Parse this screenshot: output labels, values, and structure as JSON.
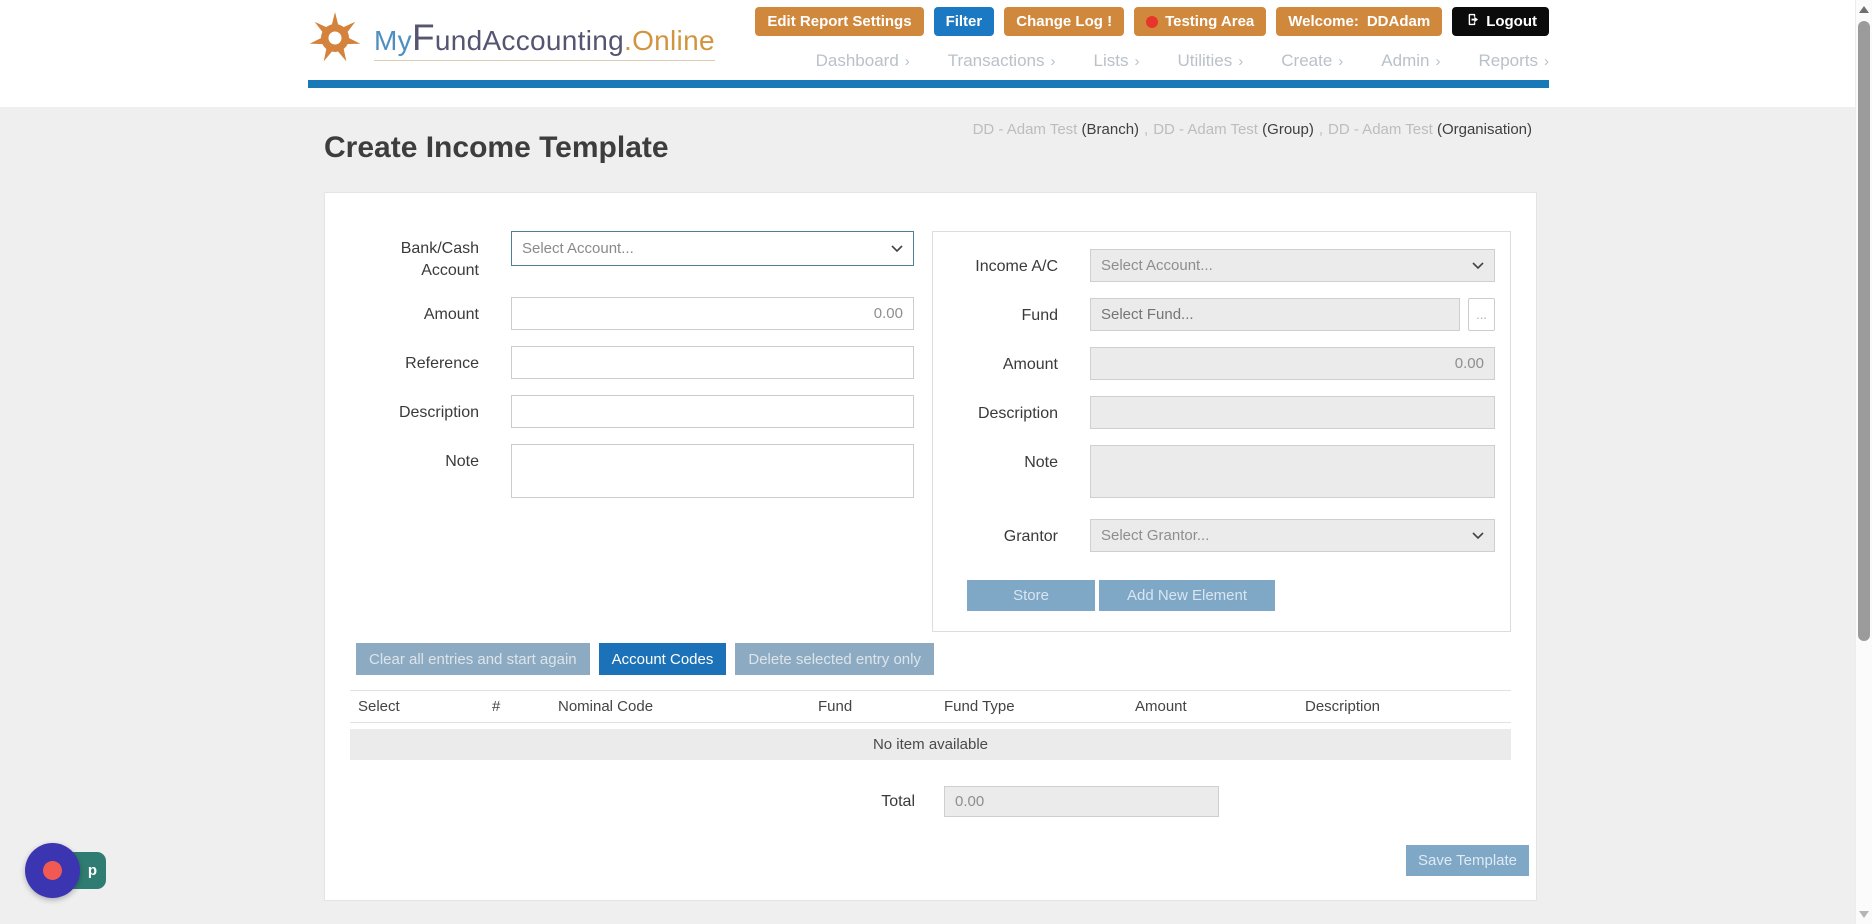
{
  "colors": {
    "toolbar_orange": "#D0883D",
    "toolbar_blue": "#1B78C2",
    "logout_black": "#0B0B0B",
    "testing_dot_red": "#E8352B",
    "nav_bar_blue": "#1878B8",
    "muted_button_blue": "#7FA7C6",
    "account_codes_blue": "#1B72B8",
    "widget_purple": "#3B35B1",
    "widget_dot_red": "#F05A52",
    "widget_teal": "#2F7D72"
  },
  "header": {
    "brand": {
      "my": "My",
      "fund": "FundAccounting",
      "online": ".Online"
    },
    "toolbar": {
      "edit_report_settings": "Edit Report Settings",
      "filter": "Filter",
      "change_log": "Change Log !",
      "testing_area": "Testing Area",
      "welcome_label": "Welcome:",
      "welcome_user": "DDAdam",
      "logout": "Logout"
    },
    "nav": {
      "items": [
        "Dashboard",
        "Transactions",
        "Lists",
        "Utilities",
        "Create",
        "Admin",
        "Reports"
      ],
      "chevron": "›"
    }
  },
  "breadcrumb": {
    "entity": "DD - Adam Test",
    "branch": "(Branch)",
    "group": "(Group)",
    "organisation": "(Organisation)",
    "separator": ","
  },
  "page_title": "Create Income Template",
  "left_form": {
    "bank_account_label": "Bank/Cash Account",
    "bank_account_value": "Select Account...",
    "amount_label": "Amount",
    "amount_value": "0.00",
    "reference_label": "Reference",
    "description_label": "Description",
    "note_label": "Note"
  },
  "right_form": {
    "income_ac_label": "Income A/C",
    "income_ac_value": "Select Account...",
    "fund_label": "Fund",
    "fund_placeholder": "Select Fund...",
    "fund_browse": "...",
    "amount_label": "Amount",
    "amount_value": "0.00",
    "description_label": "Description",
    "note_label": "Note",
    "grantor_label": "Grantor",
    "grantor_value": "Select Grantor...",
    "store_button": "Store",
    "add_new_element_button": "Add New Element"
  },
  "actions": {
    "clear_button": "Clear all entries and start again",
    "account_codes_button": "Account Codes",
    "delete_button": "Delete selected entry only"
  },
  "entries_table": {
    "headers": [
      "Select",
      "#",
      "Nominal Code",
      "Fund",
      "Fund Type",
      "Amount",
      "Description"
    ],
    "empty_text": "No item available"
  },
  "totals": {
    "label": "Total",
    "value": "0.00"
  },
  "save_template_button": "Save Template",
  "help_widget": {
    "visible_text": "p"
  }
}
